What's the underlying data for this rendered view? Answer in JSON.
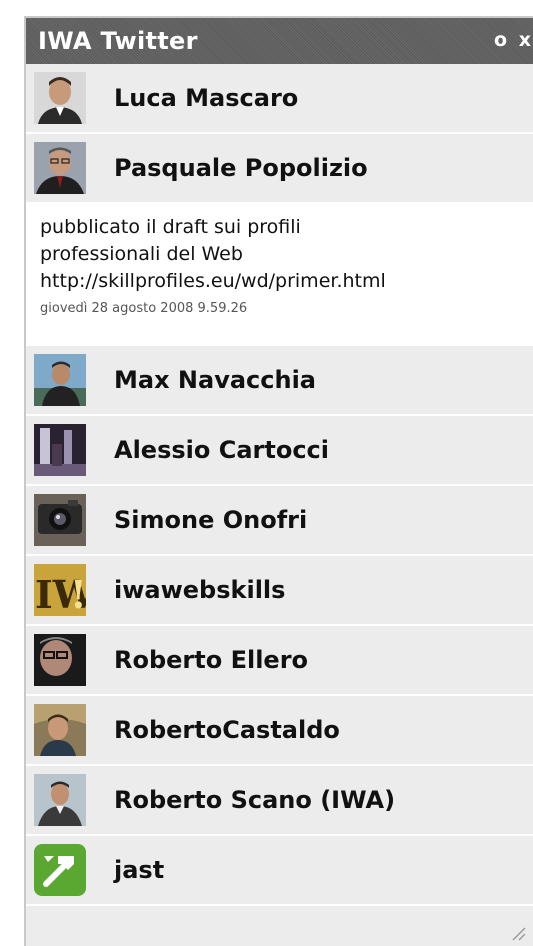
{
  "widget": {
    "title": "IWA Twitter",
    "minimize_label": "o",
    "close_label": "x"
  },
  "users": [
    {
      "name": "Luca Mascaro",
      "avatar": "person-photo-icon"
    },
    {
      "name": "Pasquale Popolizio",
      "avatar": "person-photo-icon"
    },
    {
      "name": "Max Navacchia",
      "avatar": "person-photo-icon"
    },
    {
      "name": "Alessio Cartocci",
      "avatar": "landscape-photo-icon"
    },
    {
      "name": "Simone Onofri",
      "avatar": "camera-photo-icon"
    },
    {
      "name": "iwawebskills",
      "avatar": "iwa-logo-icon"
    },
    {
      "name": "Roberto Ellero",
      "avatar": "person-photo-icon"
    },
    {
      "name": "RobertoCastaldo",
      "avatar": "person-photo-icon"
    },
    {
      "name": "Roberto Scano (IWA)",
      "avatar": "person-photo-icon"
    },
    {
      "name": "jast",
      "avatar": "hammer-logo-icon"
    }
  ],
  "expanded_tweet": {
    "line1": "pubblicato il draft sui profili",
    "line2": "professionali del Web",
    "link": "http://skillprofiles.eu/wd/primer.html",
    "timestamp": "giovedì 28 agosto 2008 9.59.26"
  },
  "colors": {
    "titlebar": "#5f5f5f",
    "row_bg": "#ececec",
    "tweet_bg": "#ffffff"
  }
}
